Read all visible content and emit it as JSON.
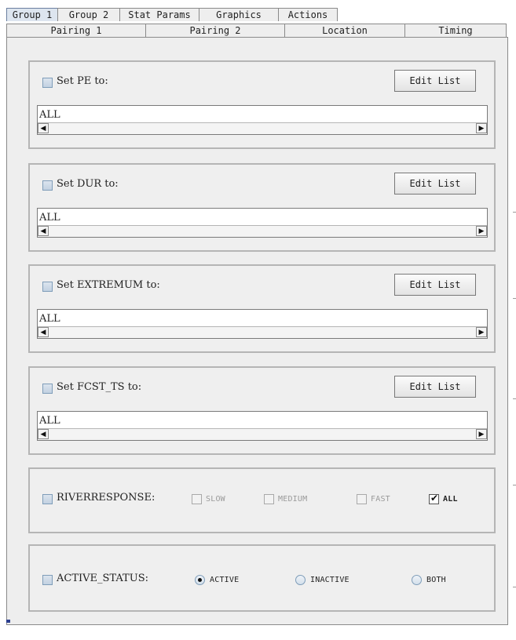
{
  "tabs_row1": [
    {
      "label": "Group 1",
      "active": true
    },
    {
      "label": "Group 2",
      "active": false
    },
    {
      "label": "Stat Params",
      "active": false
    },
    {
      "label": "Graphics",
      "active": false
    },
    {
      "label": "Actions",
      "active": false
    }
  ],
  "tabs_row2": [
    {
      "label": "Pairing 1"
    },
    {
      "label": "Pairing 2"
    },
    {
      "label": "Location"
    },
    {
      "label": "Timing"
    }
  ],
  "list_panels": [
    {
      "checkbox_label": "Set PE to:",
      "checked": false,
      "button_label": "Edit List",
      "list_value": "ALL"
    },
    {
      "checkbox_label": "Set DUR to:",
      "checked": false,
      "button_label": "Edit List",
      "list_value": "ALL"
    },
    {
      "checkbox_label": "Set EXTREMUM to:",
      "checked": false,
      "button_label": "Edit List",
      "list_value": "ALL"
    },
    {
      "checkbox_label": "Set FCST_TS to:",
      "checked": false,
      "button_label": "Edit List",
      "list_value": "ALL"
    }
  ],
  "riverresponse": {
    "label": "RIVERRESPONSE:",
    "checked": false,
    "options": [
      {
        "label": "SLOW",
        "checked": false,
        "enabled": false
      },
      {
        "label": "MEDIUM",
        "checked": false,
        "enabled": false
      },
      {
        "label": "FAST",
        "checked": false,
        "enabled": false
      },
      {
        "label": "ALL",
        "checked": true,
        "enabled": true
      }
    ]
  },
  "active_status": {
    "label": "ACTIVE_STATUS:",
    "checked": false,
    "options": [
      {
        "label": "ACTIVE",
        "selected": true
      },
      {
        "label": "INACTIVE",
        "selected": false
      },
      {
        "label": "BOTH",
        "selected": false
      }
    ]
  }
}
